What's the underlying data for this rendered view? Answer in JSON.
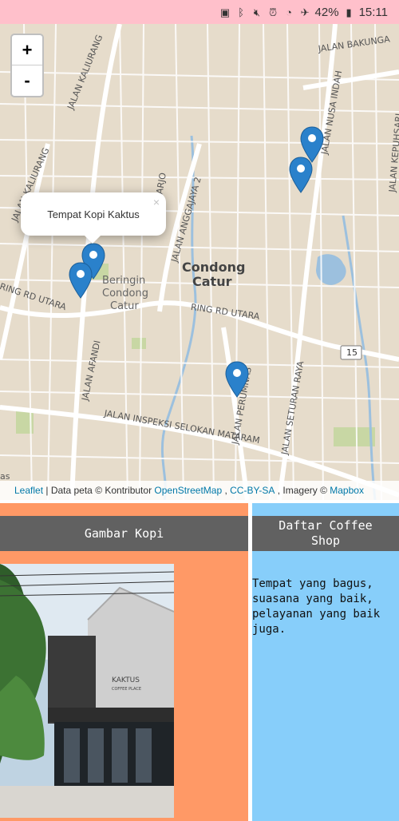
{
  "status_bar": {
    "battery_percent": "42%",
    "time": "15:11"
  },
  "map": {
    "zoom_in_label": "+",
    "zoom_out_label": "-",
    "popup_text": "Tempat Kopi Kaktus",
    "popup_close": "×",
    "labels": {
      "area_main_1": "Condong",
      "area_main_2": "Catur",
      "area_sub_1": "Beringin",
      "area_sub_2": "Condong",
      "area_sub_3": "Catur",
      "road_bakungan": "JALAN BAKUNGA",
      "road_kaliurang_n": "JALAN KALIURANG",
      "road_kaliurang_w": "JALAN KALIURANG",
      "road_nusa_indah": "JALAN NUSA INDAH",
      "road_kepuhsari": "JALAN KEPUHSARI",
      "road_hario": "HARJO",
      "road_anggajaya": "JALAN ANGGAJAYA 2",
      "road_ring_west": "RING RD UTARA",
      "road_ring_east": "RING RD UTARA",
      "road_afandi": "JALAN AFANDI",
      "road_selokan": "JALAN INSPEKSI SELOKAN MATARAM",
      "road_perumnas": "JALAN PERUMNAS",
      "road_seturan": "JALAN SETURAN RAYA",
      "route_15": "15",
      "edge_as": "as"
    },
    "attribution": {
      "leaflet": "Leaflet",
      "sep1": " | Data peta © Kontributor ",
      "osm": "OpenStreetMap",
      "sep2": " , ",
      "license": "CC-BY-SA",
      "sep3": " , Imagery © ",
      "mapbox": "Mapbox"
    }
  },
  "left_panel": {
    "title": "Gambar Kopi",
    "photo_sign_1": "KAKTUS",
    "photo_sign_2": "COFFEE PLACE"
  },
  "right_panel": {
    "title_line1": "Daftar Coffee",
    "title_line2": "Shop",
    "desc_lines": [
      "Tempat yang bagus,",
      "suasana yang baik,",
      "pelayanan yang baik",
      "juga."
    ]
  },
  "colors": {
    "status_bar": "#ffc0cb",
    "map_land": "#e6dccb",
    "marker": "#2a81cb",
    "left_panel": "#ff9966",
    "right_panel": "#87cefa",
    "panel_header": "#616161",
    "link": "#0078a8"
  },
  "icons": [
    "sim-alert-icon",
    "bluetooth-icon",
    "mute-icon",
    "alarm-icon",
    "wifi-icon",
    "airplane-icon",
    "battery-icon",
    "map-marker-icon",
    "close-icon"
  ]
}
